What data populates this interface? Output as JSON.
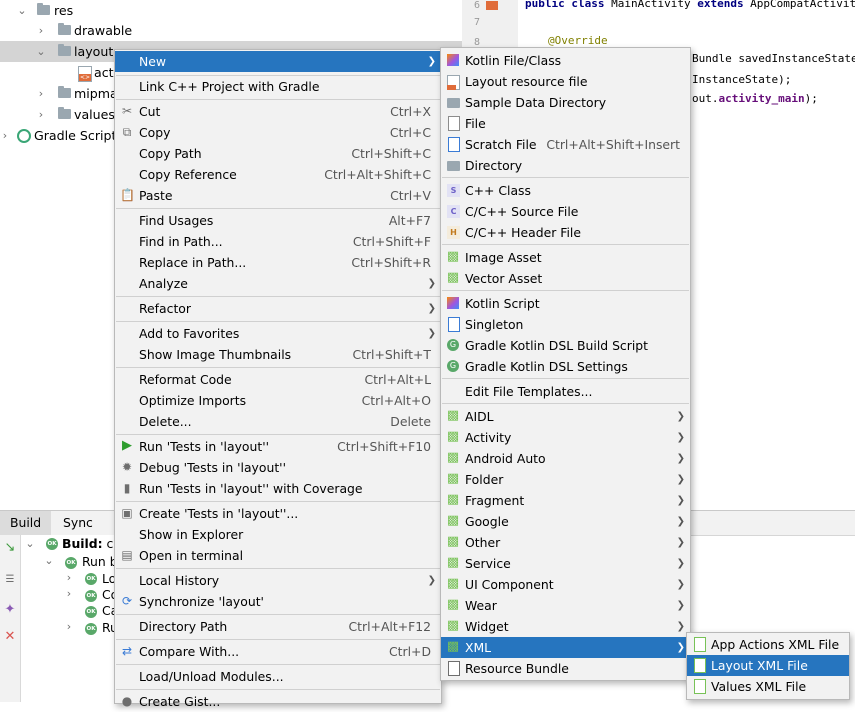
{
  "project_tree": {
    "items": [
      {
        "label": "res",
        "expanded": true,
        "icon": "folder-icon"
      },
      {
        "label": "drawable",
        "expanded": false,
        "icon": "folder-icon"
      },
      {
        "label": "layout",
        "expanded": true,
        "icon": "folder-icon",
        "selected": true
      },
      {
        "label": "acti",
        "icon": "xml-file-icon"
      },
      {
        "label": "mipma",
        "expanded": false,
        "icon": "folder-icon"
      },
      {
        "label": "values",
        "expanded": false,
        "icon": "folder-icon"
      },
      {
        "label": "Gradle Scripts",
        "expanded": false,
        "icon": "gradle-icon"
      }
    ]
  },
  "editor": {
    "line_numbers": [
      "6",
      "7",
      "8"
    ],
    "lines": [
      {
        "kw": "public class",
        "rest": " MainActivity ",
        "kw2": "extends",
        "rest2": " AppCompatActivity {"
      },
      {
        "annotation": "@Override"
      },
      {
        "text": "Bundle savedInstanceState)"
      },
      {
        "text": "InstanceState);"
      },
      {
        "text": "out.",
        "bold": "activity_main",
        "tail": ");"
      }
    ]
  },
  "build_panel": {
    "tabs": [
      "Build",
      "Sync"
    ],
    "active_tab": "Build",
    "rows": [
      {
        "label": "Build:",
        "suffix": " co"
      },
      {
        "label": "Run b"
      },
      {
        "label": "Lo"
      },
      {
        "label": "Co"
      },
      {
        "label": "Ca"
      },
      {
        "label": "Ru"
      }
    ],
    "ok_badge": "OK"
  },
  "context_menu": {
    "groups": [
      [
        {
          "label": "New",
          "submenu": true,
          "highlighted": true
        }
      ],
      [
        {
          "label": "Link C++ Project with Gradle"
        }
      ],
      [
        {
          "label": "Cut",
          "shortcut": "Ctrl+X",
          "icon": "scissors-icon"
        },
        {
          "label": "Copy",
          "shortcut": "Ctrl+C",
          "icon": "copy-icon"
        },
        {
          "label": "Copy Path",
          "shortcut": "Ctrl+Shift+C"
        },
        {
          "label": "Copy Reference",
          "shortcut": "Ctrl+Alt+Shift+C"
        },
        {
          "label": "Paste",
          "shortcut": "Ctrl+V",
          "icon": "paste-icon"
        }
      ],
      [
        {
          "label": "Find Usages",
          "shortcut": "Alt+F7"
        },
        {
          "label": "Find in Path...",
          "shortcut": "Ctrl+Shift+F"
        },
        {
          "label": "Replace in Path...",
          "shortcut": "Ctrl+Shift+R"
        },
        {
          "label": "Analyze",
          "submenu": true
        }
      ],
      [
        {
          "label": "Refactor",
          "submenu": true
        }
      ],
      [
        {
          "label": "Add to Favorites",
          "submenu": true
        },
        {
          "label": "Show Image Thumbnails",
          "shortcut": "Ctrl+Shift+T"
        }
      ],
      [
        {
          "label": "Reformat Code",
          "shortcut": "Ctrl+Alt+L"
        },
        {
          "label": "Optimize Imports",
          "shortcut": "Ctrl+Alt+O"
        },
        {
          "label": "Delete...",
          "shortcut": "Delete"
        }
      ],
      [
        {
          "label": "Run 'Tests in 'layout''",
          "shortcut": "Ctrl+Shift+F10",
          "icon": "run-icon"
        },
        {
          "label": "Debug 'Tests in 'layout''",
          "icon": "debug-icon"
        },
        {
          "label": "Run 'Tests in 'layout'' with Coverage",
          "icon": "coverage-icon"
        }
      ],
      [
        {
          "label": "Create 'Tests in 'layout''...",
          "icon": "create-test-icon"
        },
        {
          "label": "Show in Explorer"
        },
        {
          "label": "Open in terminal",
          "icon": "terminal-icon"
        }
      ],
      [
        {
          "label": "Local History",
          "submenu": true
        },
        {
          "label": "Synchronize 'layout'",
          "icon": "sync-icon"
        }
      ],
      [
        {
          "label": "Directory Path",
          "shortcut": "Ctrl+Alt+F12"
        }
      ],
      [
        {
          "label": "Compare With...",
          "shortcut": "Ctrl+D",
          "icon": "compare-icon"
        }
      ],
      [
        {
          "label": "Load/Unload Modules..."
        }
      ],
      [
        {
          "label": "Create Gist...",
          "icon": "github-icon"
        }
      ]
    ]
  },
  "new_submenu": {
    "groups": [
      [
        {
          "label": "Kotlin File/Class",
          "icon": "kotlin-icon"
        },
        {
          "label": "Layout resource file",
          "icon": "layout-file-icon"
        },
        {
          "label": "Sample Data Directory",
          "icon": "folder-icon"
        },
        {
          "label": "File",
          "icon": "file-icon"
        },
        {
          "label": "Scratch File",
          "shortcut": "Ctrl+Alt+Shift+Insert",
          "icon": "scratch-file-icon"
        },
        {
          "label": "Directory",
          "icon": "folder-icon"
        }
      ],
      [
        {
          "label": "C++ Class",
          "icon": "cpp-class-icon"
        },
        {
          "label": "C/C++ Source File",
          "icon": "cpp-source-icon"
        },
        {
          "label": "C/C++ Header File",
          "icon": "cpp-header-icon"
        }
      ],
      [
        {
          "label": "Image Asset",
          "icon": "android-icon"
        },
        {
          "label": "Vector Asset",
          "icon": "android-icon"
        }
      ],
      [
        {
          "label": "Kotlin Script",
          "icon": "kotlin-script-icon"
        },
        {
          "label": "Singleton",
          "icon": "singleton-icon"
        },
        {
          "label": "Gradle Kotlin DSL Build Script",
          "icon": "gradle-icon"
        },
        {
          "label": "Gradle Kotlin DSL Settings",
          "icon": "gradle-icon"
        }
      ],
      [
        {
          "label": "Edit File Templates..."
        }
      ],
      [
        {
          "label": "AIDL",
          "submenu": true,
          "icon": "android-icon"
        },
        {
          "label": "Activity",
          "submenu": true,
          "icon": "android-icon"
        },
        {
          "label": "Android Auto",
          "submenu": true,
          "icon": "android-icon"
        },
        {
          "label": "Folder",
          "submenu": true,
          "icon": "android-icon"
        },
        {
          "label": "Fragment",
          "submenu": true,
          "icon": "android-icon"
        },
        {
          "label": "Google",
          "submenu": true,
          "icon": "android-icon"
        },
        {
          "label": "Other",
          "submenu": true,
          "icon": "android-icon"
        },
        {
          "label": "Service",
          "submenu": true,
          "icon": "android-icon"
        },
        {
          "label": "UI Component",
          "submenu": true,
          "icon": "android-icon"
        },
        {
          "label": "Wear",
          "submenu": true,
          "icon": "android-icon"
        },
        {
          "label": "Widget",
          "submenu": true,
          "icon": "android-icon"
        },
        {
          "label": "XML",
          "submenu": true,
          "icon": "android-icon",
          "highlighted": true
        },
        {
          "label": "Resource Bundle",
          "icon": "resource-bundle-icon"
        }
      ]
    ]
  },
  "xml_submenu": {
    "items": [
      {
        "label": "App Actions XML File",
        "icon": "xml-file-icon"
      },
      {
        "label": "Layout XML File",
        "icon": "xml-file-icon",
        "highlighted": true
      },
      {
        "label": "Values XML File",
        "icon": "xml-file-icon"
      }
    ]
  },
  "colors": {
    "highlight": "#2675bf",
    "menu_bg": "#f2f2f2",
    "android_green": "#78c257",
    "tree_selected": "#d4d4d4"
  }
}
